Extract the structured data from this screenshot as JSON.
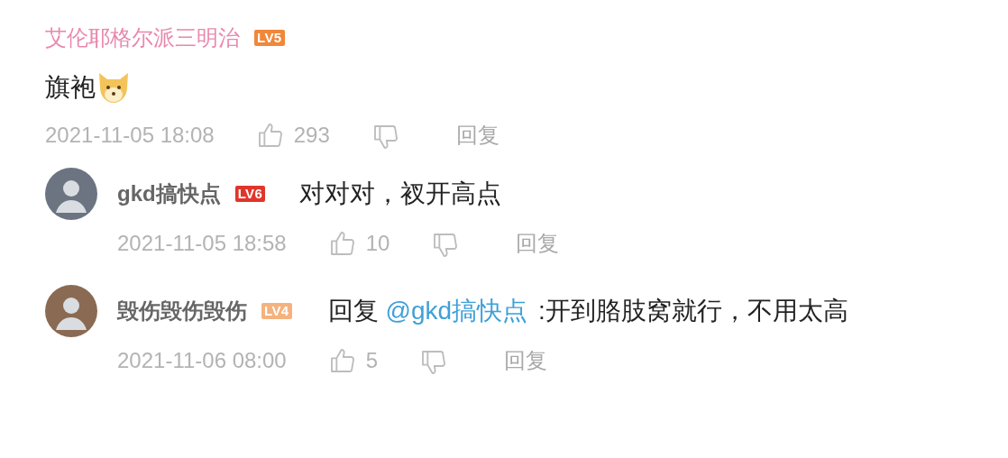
{
  "comment": {
    "username": "艾伦耶格尔派三明治",
    "badge": {
      "text": "LV5",
      "color": "#f0873a"
    },
    "text": "旗袍",
    "time": "2021-11-05 18:08",
    "likes": "293",
    "reply_label": "回复"
  },
  "replies": [
    {
      "kind": "plain",
      "username": "gkd搞快点",
      "badge": {
        "text": "LV6",
        "color": "#e0352b"
      },
      "text": "对对对，衩开高点",
      "time": "2021-11-05 18:58",
      "likes": "10",
      "reply_label": "回复"
    },
    {
      "kind": "reply_to",
      "username": "毁伤毁伤毁伤",
      "badge": {
        "text": "LV4",
        "color": "#f5b27e"
      },
      "prefix": "回复",
      "mention": "@gkd搞快点",
      "text": ":开到胳肢窝就行，不用太高",
      "time": "2021-11-06 08:00",
      "likes": "5",
      "reply_label": "回复"
    }
  ]
}
